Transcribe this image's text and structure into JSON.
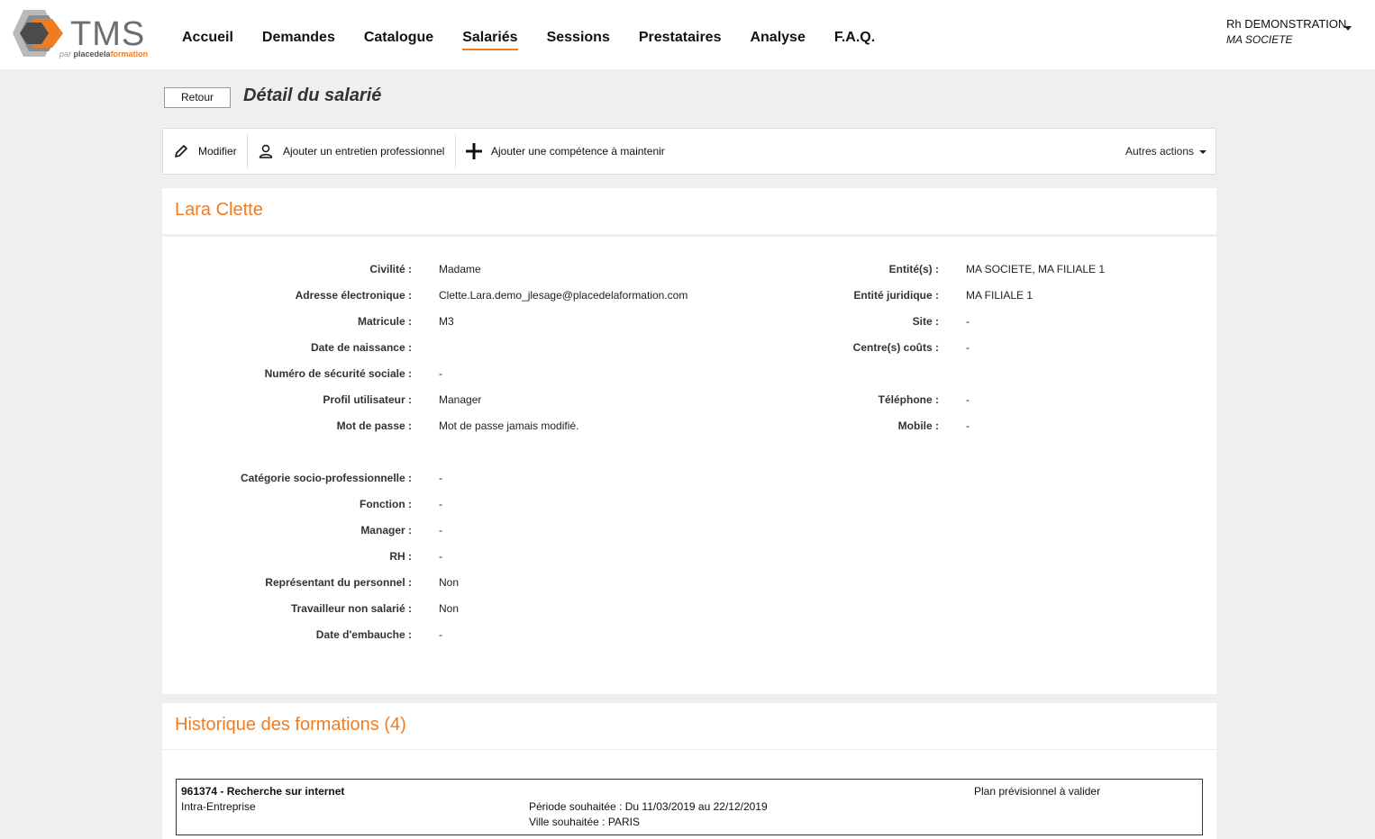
{
  "brand": {
    "name": "TMS",
    "sub_par": "par",
    "sub_bold": "placedela",
    "sub_orange": "formation",
    "accent_color": "#f07c22"
  },
  "nav": [
    "Accueil",
    "Demandes",
    "Catalogue",
    "Salariés",
    "Sessions",
    "Prestataires",
    "Analyse",
    "F.A.Q."
  ],
  "nav_active": "Salariés",
  "user": {
    "name": "Rh DEMONSTRATION",
    "company": "MA SOCIETE"
  },
  "page": {
    "back_label": "Retour",
    "title": "Détail du salarié"
  },
  "toolbar": {
    "edit_label": "Modifier",
    "interview_label": "Ajouter un entretien professionnel",
    "skill_label": "Ajouter une compétence à maintenir",
    "more_label": "Autres actions"
  },
  "employee": {
    "name": "Lara Clette",
    "left_fields": [
      {
        "label": "Civilité :",
        "value": "Madame"
      },
      {
        "label": "Adresse électronique :",
        "value": "Clette.Lara.demo_jlesage@placedelaformation.com"
      },
      {
        "label": "Matricule :",
        "value": "M3"
      },
      {
        "label": "Date de naissance :",
        "value": ""
      },
      {
        "label": "Numéro de sécurité sociale :",
        "value": "-"
      },
      {
        "label": "Profil utilisateur :",
        "value": "Manager"
      },
      {
        "label": "Mot de passe :",
        "value": "Mot de passe jamais modifié."
      },
      {
        "label": "Catégorie socio-professionnelle :",
        "value": "-"
      },
      {
        "label": "Fonction :",
        "value": "-"
      },
      {
        "label": "Manager :",
        "value": "-"
      },
      {
        "label": "RH :",
        "value": "-"
      },
      {
        "label": "Représentant du personnel :",
        "value": "Non"
      },
      {
        "label": "Travailleur non salarié :",
        "value": "Non"
      },
      {
        "label": "Date d'embauche :",
        "value": "-"
      }
    ],
    "right_fields": [
      {
        "label": "Entité(s) :",
        "value": "MA SOCIETE, MA FILIALE 1"
      },
      {
        "label": "Entité juridique :",
        "value": "MA FILIALE 1"
      },
      {
        "label": "Site :",
        "value": "-"
      },
      {
        "label": "Centre(s) coûts :",
        "value": "-"
      },
      {
        "label": "Téléphone :",
        "value": "-"
      },
      {
        "label": "Mobile :",
        "value": "-"
      }
    ]
  },
  "history": {
    "title": "Historique des formations (4)",
    "items": [
      {
        "title": "961374 - Recherche sur internet",
        "type": "Intra-Entreprise",
        "period": "Période souhaitée : Du 11/03/2019 au 22/12/2019",
        "city": "Ville souhaitée : PARIS",
        "status": "Plan prévisionnel à valider"
      }
    ]
  }
}
